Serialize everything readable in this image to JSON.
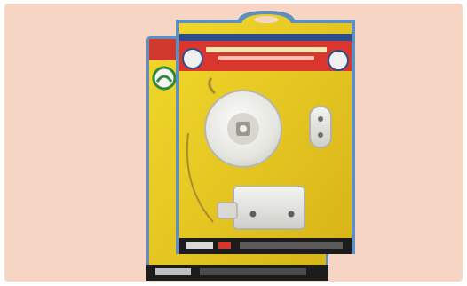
{
  "image": {
    "description_tag": "product-photo",
    "background_color": "#f6d5c5",
    "card_color": "#e8c51a",
    "card_edge_color": "#6ea7d6",
    "header_color": "#d9362e",
    "anode_color": "#ececea"
  }
}
